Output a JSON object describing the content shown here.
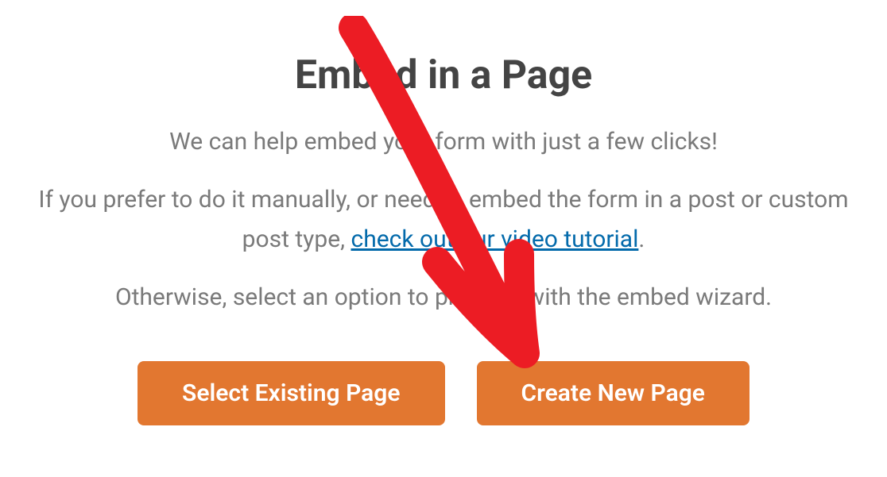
{
  "modal": {
    "title": "Embed in a Page",
    "subtitle": "We can help embed your form with just a few clicks!",
    "instruction_prefix": "If you prefer to do it manually, or need to embed the form in a post or custom post type, ",
    "instruction_link": "check out our video tutorial",
    "instruction_suffix": ".",
    "wizard_text": "Otherwise, select an option to proceed with the embed wizard.",
    "buttons": {
      "select_existing": "Select Existing Page",
      "create_new": "Create New Page"
    }
  },
  "annotation": {
    "arrow_color": "#ec1c24",
    "target": "create-new-page-button"
  }
}
